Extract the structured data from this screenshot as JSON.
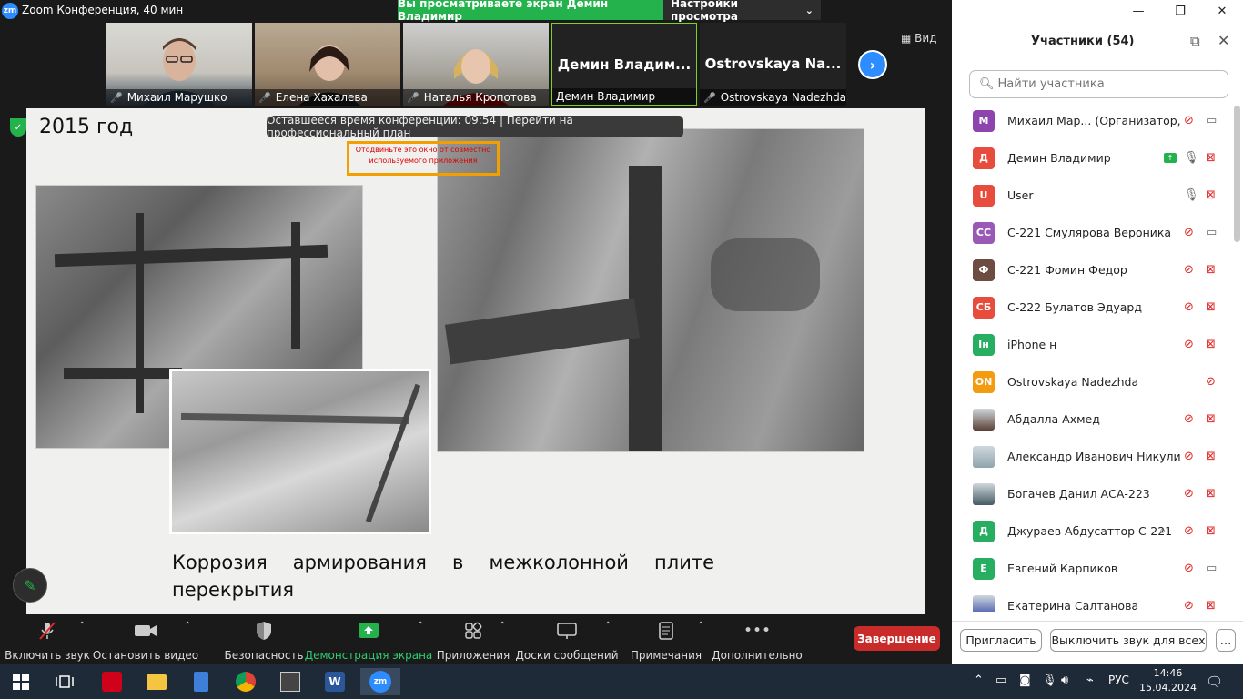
{
  "window": {
    "logo": "zm",
    "title": "Zoom Конференция, 40 мин"
  },
  "banner": {
    "viewing": "Вы просматриваете экран Демин Владимир",
    "settings": "Настройки просмотра"
  },
  "tiles": [
    {
      "name": "Михаил Марушко",
      "muted": true,
      "video": true
    },
    {
      "name": "Елена Хахалева",
      "muted": true,
      "video": true
    },
    {
      "name": "Наталья Кропотова",
      "muted": true,
      "video": true
    },
    {
      "name": "Демин Владимир",
      "display": "Демин Владим...",
      "muted": false,
      "video": false
    },
    {
      "name": "Ostrovskaya Nadezhda",
      "display": "Ostrovskaya Na...",
      "muted": true,
      "video": false
    }
  ],
  "view_label": "Вид",
  "timer": "Оставшееся время конференции: 09:54 | Перейти на профессиональный план",
  "overlay_message": "Отодвиньте это окно от совместно используемого приложения",
  "slide": {
    "year": "2015 год",
    "caption": "Коррозия армирования в межколонной плите перекрытия"
  },
  "toolbar": [
    {
      "label": "Включить звук",
      "icon": "mic-muted-icon"
    },
    {
      "label": "Остановить видео",
      "icon": "video-camera-icon"
    },
    {
      "label": "Безопасность",
      "icon": "shield-icon"
    },
    {
      "label": "Демонстрация экрана",
      "icon": "share-screen-icon"
    },
    {
      "label": "Приложения",
      "icon": "apps-icon"
    },
    {
      "label": "Доски сообщений",
      "icon": "whiteboard-icon"
    },
    {
      "label": "Примечания",
      "icon": "notes-icon"
    },
    {
      "label": "Дополнительно",
      "icon": "more-icon"
    }
  ],
  "end_button": "Завершение",
  "panel": {
    "title": "Участники (54)",
    "search_placeholder": "Найти участника",
    "invite": "Пригласить",
    "mute_all": "Выключить звук для всех",
    "more": "…"
  },
  "participants": [
    {
      "initials": "М",
      "color": "#8e44ad",
      "name": "Михаил Мар... (Организатор, я)",
      "mic": "muted",
      "video": "on"
    },
    {
      "initials": "Д",
      "color": "#e74c3c",
      "name": "Демин Владимир",
      "mic": "on",
      "video": "off",
      "sharing": true
    },
    {
      "initials": "U",
      "color": "#e74c3c",
      "name": "User",
      "mic": "on",
      "video": "off"
    },
    {
      "initials": "СС",
      "color": "#9b59b6",
      "name": "С-221 Смулярова Вероника",
      "mic": "muted",
      "video": "on"
    },
    {
      "initials": "Ф",
      "color": "#6d4c41",
      "name": "С-221 Фомин Федор",
      "mic": "muted",
      "video": "off"
    },
    {
      "initials": "СБ",
      "color": "#e74c3c",
      "name": "С-222 Булатов Эдуард",
      "mic": "muted",
      "video": "off"
    },
    {
      "initials": "Ін",
      "color": "#27ae60",
      "name": "iPhone н",
      "mic": "muted",
      "video": "off"
    },
    {
      "initials": "ON",
      "color": "#f39c12",
      "name": "Ostrovskaya Nadezhda",
      "mic": "muted",
      "video": "none"
    },
    {
      "initials": "",
      "color": "#5d4037",
      "name": "Абдалла Ахмед",
      "mic": "muted",
      "video": "off",
      "photo": true
    },
    {
      "initials": "",
      "color": "#90a4ae",
      "name": "Александр Иванович Никулин",
      "mic": "muted",
      "video": "off",
      "photo": true
    },
    {
      "initials": "",
      "color": "#455a64",
      "name": "Богачев Данил АСА-223",
      "mic": "muted",
      "video": "off",
      "photo": true
    },
    {
      "initials": "Д",
      "color": "#27ae60",
      "name": "Джураев Абдусаттор С-221",
      "mic": "muted",
      "video": "off",
      "raised": true
    },
    {
      "initials": "Е",
      "color": "#27ae60",
      "name": "Евгений Карпиков",
      "mic": "muted",
      "video": "on"
    },
    {
      "initials": "",
      "color": "#3949ab",
      "name": "Екатерина Салтанова",
      "mic": "muted",
      "video": "off",
      "photo": true
    }
  ],
  "tray": {
    "lang": "РУС",
    "time": "14:46",
    "date": "15.04.2024"
  }
}
